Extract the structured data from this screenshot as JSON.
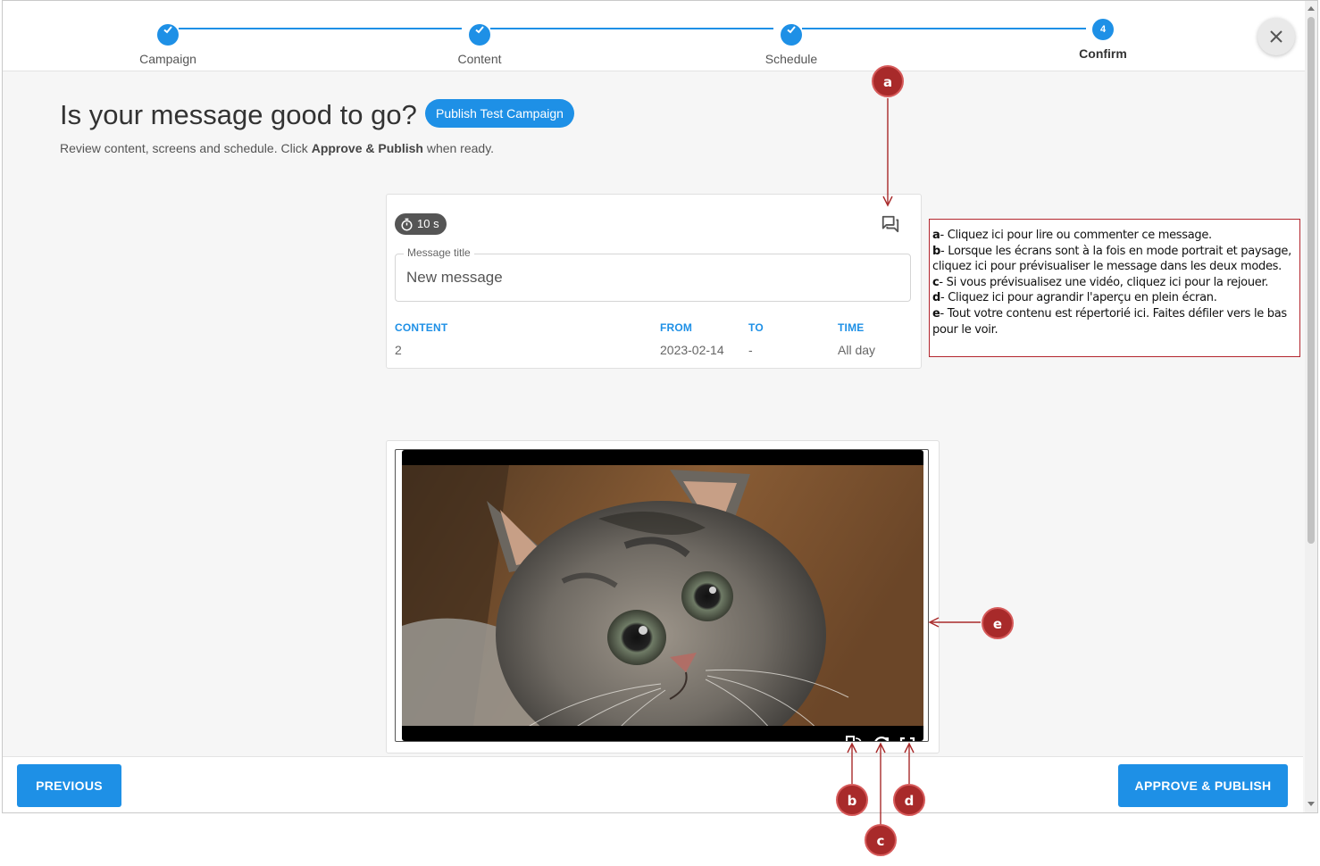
{
  "stepper": {
    "steps": [
      {
        "label": "Campaign",
        "state": "done"
      },
      {
        "label": "Content",
        "state": "done"
      },
      {
        "label": "Schedule",
        "state": "done"
      },
      {
        "label": "Confirm",
        "state": "active",
        "number": "4"
      }
    ]
  },
  "header": {
    "title": "Is your message good to go?",
    "test_button": "Publish Test Campaign",
    "subtitle_pre": "Review content, screens and schedule. Click ",
    "subtitle_bold": "Approve & Publish",
    "subtitle_post": " when ready."
  },
  "message": {
    "duration": "10 s",
    "title_label": "Message title",
    "title_value": "New message",
    "columns": {
      "content": "CONTENT",
      "from": "FROM",
      "to": "TO",
      "time": "TIME"
    },
    "values": {
      "content": "2",
      "from": "2023-02-14",
      "to": "-",
      "time": "All day"
    }
  },
  "preview": {
    "image_subject": "kitten photo",
    "controls": [
      "orientation-toggle-icon",
      "replay-icon",
      "fullscreen-icon"
    ]
  },
  "footer": {
    "previous": "PREVIOUS",
    "approve": "APPROVE & PUBLISH"
  },
  "annotations": {
    "markers": [
      "a",
      "b",
      "c",
      "d",
      "e"
    ],
    "notes": [
      {
        "key": "a",
        "text": "- Cliquez ici pour lire ou commenter ce message."
      },
      {
        "key": "b",
        "text": "- Lorsque les écrans sont à la fois en mode portrait et paysage, cliquez ici pour prévisualiser le message dans les deux modes."
      },
      {
        "key": "c",
        "text": "- Si vous prévisualisez une vidéo, cliquez ici pour la rejouer."
      },
      {
        "key": "d",
        "text": "- Cliquez ici pour agrandir l'aperçu en plein écran."
      },
      {
        "key": "e",
        "text": "- Tout votre contenu est répertorié ici. Faites défiler vers le bas pour le voir."
      }
    ],
    "color": "#a82a2a"
  },
  "colors": {
    "accent": "#1e90e6",
    "background": "#f6f6f6"
  }
}
